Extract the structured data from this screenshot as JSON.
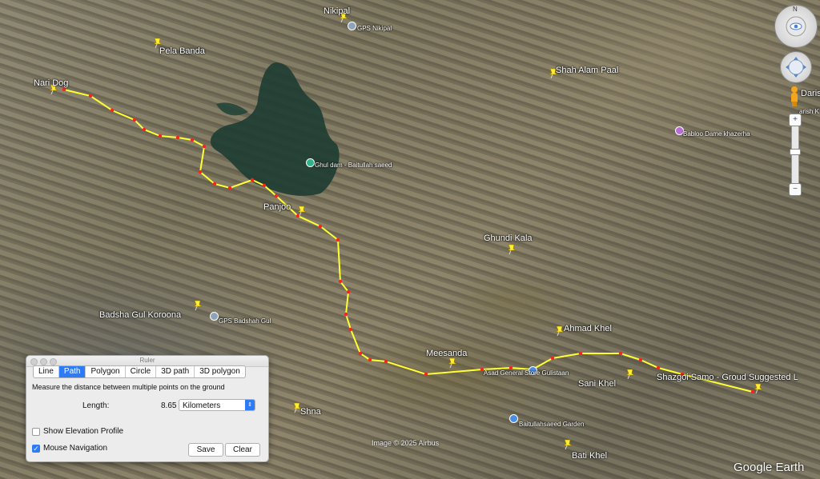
{
  "map": {
    "places": [
      {
        "id": "nikipal",
        "label": "Nikipal"
      },
      {
        "id": "gps-nikipal",
        "label": "GPS Nikipal"
      },
      {
        "id": "pela-banda",
        "label": "Pela Banda"
      },
      {
        "id": "shah-alam-paal",
        "label": "Shah Alam Paal"
      },
      {
        "id": "nari-dog",
        "label": "Nari Dog"
      },
      {
        "id": "ghul-dam",
        "label": "Ghul dam - Baitullah saeed"
      },
      {
        "id": "babloo-dame",
        "label": "Babloo Dame khazerha"
      },
      {
        "id": "panjoo",
        "label": "Panjoo"
      },
      {
        "id": "ghundi-kala",
        "label": "Ghundi Kala"
      },
      {
        "id": "badsha-gul",
        "label": "Badsha Gul Koroona"
      },
      {
        "id": "gps-badshah-gul",
        "label": "GPS Badshah Gul"
      },
      {
        "id": "ahmad-khel",
        "label": "Ahmad Khel"
      },
      {
        "id": "meesanda",
        "label": "Meesanda"
      },
      {
        "id": "asad-store",
        "label": "Asad General Store Gulistaan"
      },
      {
        "id": "sani-khel",
        "label": "Sani Khel"
      },
      {
        "id": "shazgoi",
        "label": "Shazgoi Samo - Groud Suggested L"
      },
      {
        "id": "shna",
        "label": "Shna"
      },
      {
        "id": "baitullah-garden",
        "label": "Baitullahsaeed Garden"
      },
      {
        "id": "bati-khel",
        "label": "Bati Khel"
      },
      {
        "id": "darish",
        "label": "Daris"
      },
      {
        "id": "darish2",
        "label": "arish K"
      }
    ],
    "image_credit": "Image © 2025 Airbus",
    "logo": "Google Earth",
    "compass_letter": "N",
    "path_color": "#ffff33",
    "vertex_color": "#ff2020"
  },
  "ruler": {
    "title": "Ruler",
    "tabs": [
      "Line",
      "Path",
      "Polygon",
      "Circle",
      "3D path",
      "3D polygon"
    ],
    "active_tab": "Path",
    "description": "Measure the distance between multiple points on the ground",
    "length_label": "Length:",
    "length_value": "8.65",
    "unit": "Kilometers",
    "show_elevation_label": "Show Elevation Profile",
    "show_elevation_checked": false,
    "mouse_nav_label": "Mouse Navigation",
    "mouse_nav_checked": true,
    "save_label": "Save",
    "clear_label": "Clear"
  }
}
